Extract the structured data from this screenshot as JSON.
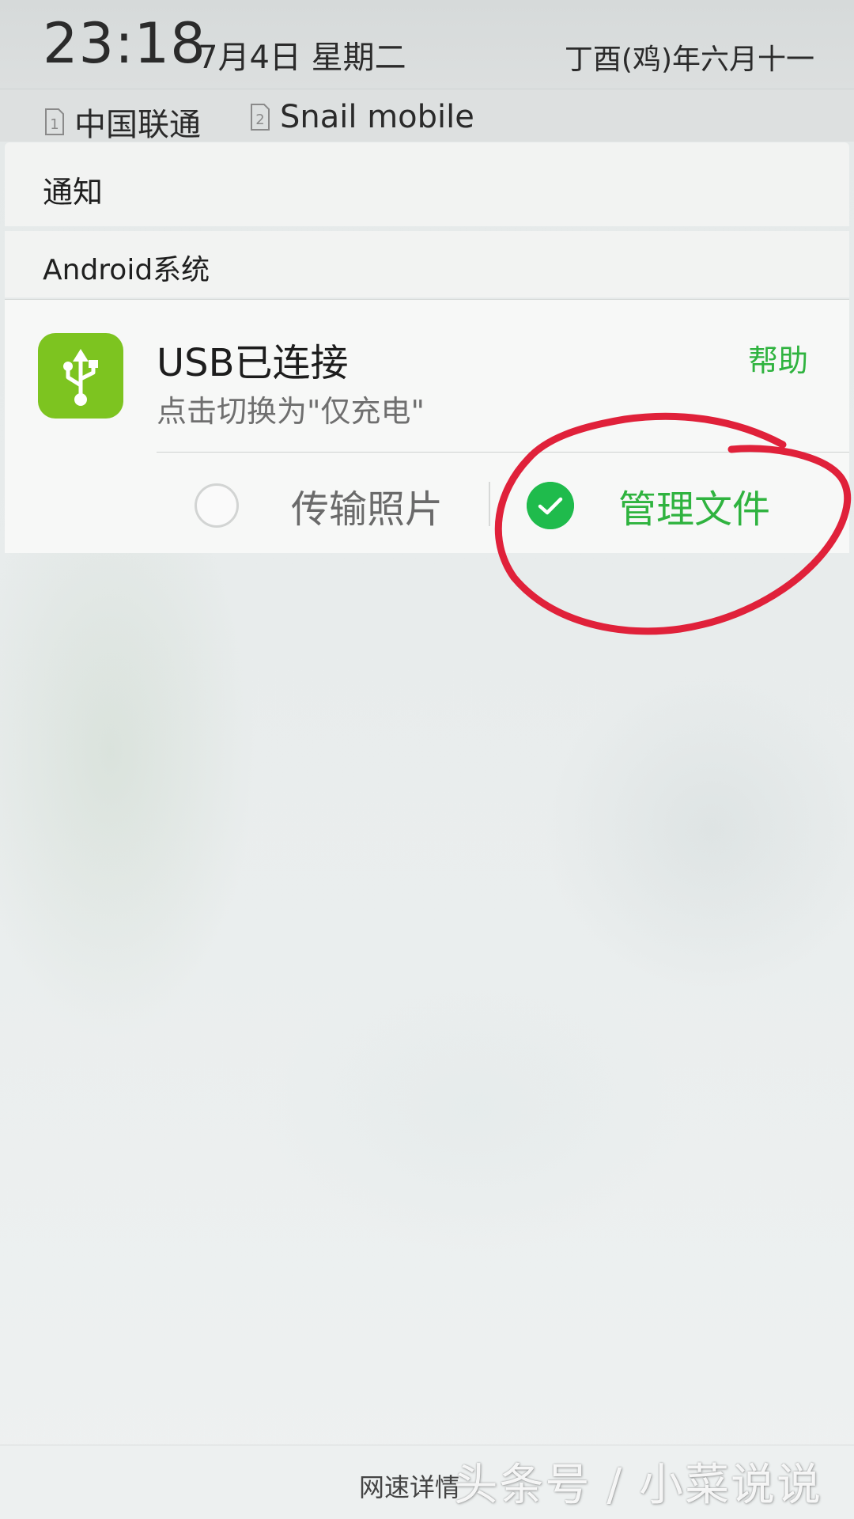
{
  "status": {
    "time": "23:18",
    "date": "7月4日 星期二",
    "lunar_date": "丁酉(鸡)年六月十一"
  },
  "sims": [
    {
      "slot": "1",
      "carrier": "中国联通"
    },
    {
      "slot": "2",
      "carrier": "Snail mobile"
    }
  ],
  "notifications": {
    "header": "通知",
    "group_title": "Android系统",
    "usb": {
      "icon": "usb-icon",
      "title": "USB已连接",
      "subtitle": "点击切换为\"仅充电\"",
      "help_label": "帮助",
      "options": [
        {
          "label": "传输照片",
          "selected": false
        },
        {
          "label": "管理文件",
          "selected": true
        }
      ]
    }
  },
  "footer": {
    "net_speed_label": "网速详情"
  },
  "watermark": "头条号 / 小菜说说",
  "colors": {
    "accent_green": "#2fb33f",
    "check_green": "#1fbb4c",
    "usb_icon_bg": "#7dc420",
    "annotation_red": "#e0213a"
  }
}
